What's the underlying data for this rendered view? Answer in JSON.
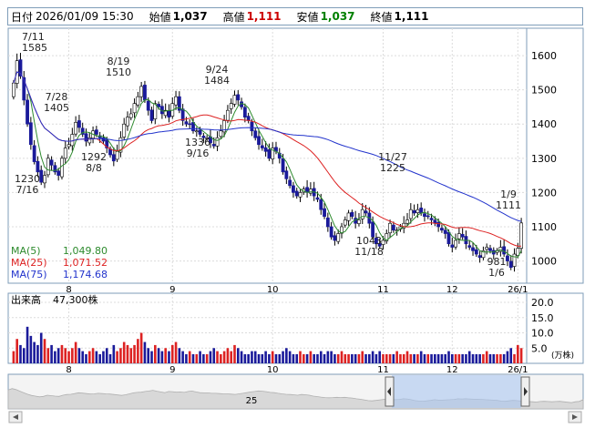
{
  "header": {
    "date_label": "日付",
    "date_value": "2026/01/09 15:30",
    "open_label": "始値",
    "open_value": "1,037",
    "high_label": "高値",
    "high_value": "1,111",
    "low_label": "安値",
    "low_value": "1,037",
    "close_label": "終値",
    "close_value": "1,111"
  },
  "colors": {
    "up": "#dd2222",
    "down": "#1a1a9a",
    "ma5": "#2e8b2e",
    "ma25": "#dd2222",
    "ma75": "#2233cc",
    "high_text": "#cc0000",
    "low_text": "#008000"
  },
  "chart_data": {
    "type": "candlestick",
    "price_axis": {
      "ticks": [
        1000,
        1100,
        1200,
        1300,
        1400,
        1500,
        1600
      ],
      "ylim": [
        935,
        1680
      ]
    },
    "x_ticks": [
      "8",
      "9",
      "10",
      "11",
      "12",
      "26/1"
    ],
    "annotations": [
      {
        "date": "7/11",
        "value": "1585"
      },
      {
        "date": "7/16",
        "value": "1230"
      },
      {
        "date": "7/28",
        "value": "1405"
      },
      {
        "date": "8/8",
        "value": "1292"
      },
      {
        "date": "8/19",
        "value": "1510"
      },
      {
        "date": "9/16",
        "value": "1336"
      },
      {
        "date": "9/24",
        "value": "1484"
      },
      {
        "date": "11/18",
        "value": "1043"
      },
      {
        "date": "11/27",
        "value": "1225"
      },
      {
        "date": "1/6",
        "value": "981"
      },
      {
        "date": "1/9",
        "value": "1111"
      }
    ],
    "legend": [
      {
        "name": "MA(5)",
        "value": "1,049.80"
      },
      {
        "name": "MA(25)",
        "value": "1,071.52"
      },
      {
        "name": "MA(75)",
        "value": "1,174.68"
      }
    ],
    "closes": [
      1520,
      1585,
      1540,
      1470,
      1400,
      1340,
      1290,
      1260,
      1230,
      1250,
      1300,
      1280,
      1260,
      1250,
      1300,
      1330,
      1340,
      1370,
      1405,
      1390,
      1370,
      1350,
      1360,
      1380,
      1370,
      1360,
      1350,
      1330,
      1310,
      1292,
      1320,
      1360,
      1400,
      1420,
      1430,
      1460,
      1480,
      1510,
      1470,
      1440,
      1410,
      1460,
      1450,
      1430,
      1440,
      1420,
      1460,
      1480,
      1440,
      1410,
      1400,
      1400,
      1380,
      1380,
      1370,
      1360,
      1360,
      1345,
      1336,
      1360,
      1380,
      1410,
      1440,
      1460,
      1484,
      1470,
      1450,
      1420,
      1410,
      1380,
      1360,
      1340,
      1330,
      1320,
      1300,
      1330,
      1320,
      1300,
      1260,
      1240,
      1220,
      1200,
      1190,
      1200,
      1210,
      1200,
      1210,
      1190,
      1180,
      1150,
      1130,
      1100,
      1070,
      1060,
      1080,
      1100,
      1120,
      1140,
      1130,
      1110,
      1120,
      1150,
      1140,
      1110,
      1070,
      1050,
      1043,
      1060,
      1080,
      1110,
      1090,
      1090,
      1100,
      1110,
      1120,
      1150,
      1140,
      1150,
      1140,
      1130,
      1130,
      1120,
      1110,
      1100,
      1090,
      1080,
      1050,
      1040,
      1060,
      1080,
      1070,
      1050,
      1040,
      1030,
      1020,
      1010,
      1030,
      1040,
      1030,
      1020,
      1030,
      1040,
      1020,
      1000,
      981,
      1020,
      1037,
      1111
    ],
    "volume": [
      4,
      8,
      6,
      5,
      12,
      9,
      7,
      6,
      10,
      8,
      5,
      6,
      4,
      5,
      6,
      5,
      4,
      5,
      7,
      5,
      4,
      3,
      4,
      5,
      4,
      3,
      4,
      5,
      3,
      6,
      4,
      5,
      7,
      6,
      5,
      6,
      8,
      10,
      7,
      5,
      4,
      6,
      5,
      4,
      5,
      4,
      6,
      7,
      5,
      4,
      3,
      4,
      3,
      3,
      4,
      3,
      3,
      4,
      5,
      4,
      3,
      4,
      5,
      4,
      6,
      5,
      4,
      3,
      3,
      4,
      4,
      3,
      3,
      4,
      3,
      4,
      3,
      3,
      4,
      5,
      4,
      3,
      3,
      4,
      3,
      3,
      4,
      3,
      3,
      4,
      3,
      4,
      4,
      3,
      3,
      4,
      3,
      3,
      3,
      3,
      3,
      4,
      3,
      3,
      4,
      3,
      4,
      3,
      3,
      3,
      3,
      4,
      3,
      3,
      4,
      3,
      3,
      3,
      4,
      3,
      3,
      3,
      3,
      3,
      3,
      3,
      4,
      3,
      3,
      3,
      3,
      3,
      4,
      3,
      3,
      3,
      3,
      4,
      3,
      3,
      3,
      3,
      3,
      4,
      5,
      3,
      6,
      5
    ],
    "volume_axis": {
      "ticks": [
        "5.0",
        "10.0",
        "15.0",
        "20.0"
      ],
      "unit": "(万株)",
      "ylim": [
        0,
        23
      ]
    },
    "volume_label": "出来高",
    "volume_value": "47,300株",
    "navigator_label": "25"
  }
}
